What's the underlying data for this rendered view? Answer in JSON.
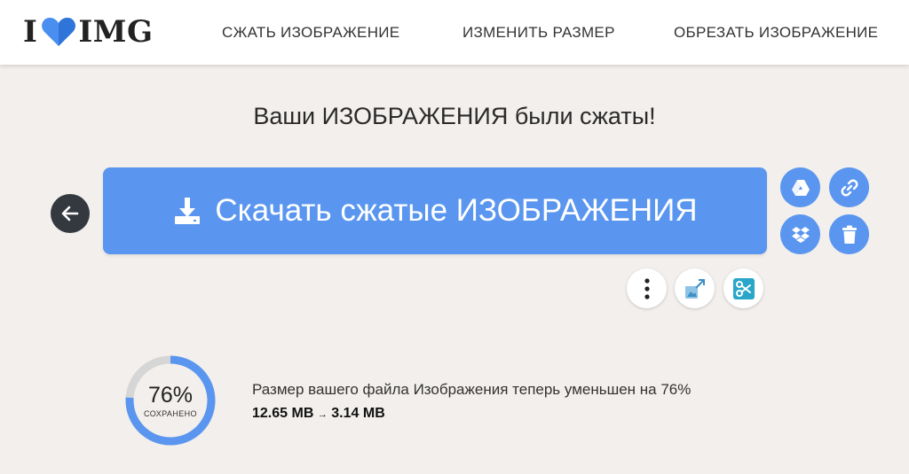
{
  "header": {
    "logo": {
      "left": "I",
      "right": "IMG"
    },
    "nav": [
      {
        "label": "СЖАТЬ ИЗОБРАЖЕНИЕ"
      },
      {
        "label": "ИЗМЕНИТЬ РАЗМЕР"
      },
      {
        "label": "ОБРЕЗАТЬ ИЗОБРАЖЕНИЕ"
      }
    ]
  },
  "main": {
    "title": "Ваши ИЗОБРАЖЕНИЯ были сжаты!",
    "download_label": "Скачать сжатые ИЗОБРАЖЕНИЯ",
    "back_icon": "arrow-left-icon",
    "side_actions": [
      {
        "icon": "google-drive-icon"
      },
      {
        "icon": "link-icon"
      },
      {
        "icon": "dropbox-icon"
      },
      {
        "icon": "trash-icon"
      }
    ],
    "tools": [
      {
        "icon": "more-vertical-icon"
      },
      {
        "icon": "resize-image-icon"
      },
      {
        "icon": "crop-image-icon"
      }
    ]
  },
  "result": {
    "percent_text": "76%",
    "percent_value": 76,
    "saved_label": "СОХРАНЕНО",
    "description": "Размер вашего файла Изображения теперь уменьшен на 76%",
    "before": "12.65 MB",
    "after": "3.14 MB",
    "arrow": "→"
  },
  "colors": {
    "background": "#f2efec",
    "accent": "#5a96ef",
    "dark_button": "#33393f",
    "ring_track": "#d6d6d6",
    "crop_icon": "#29a6c9"
  }
}
